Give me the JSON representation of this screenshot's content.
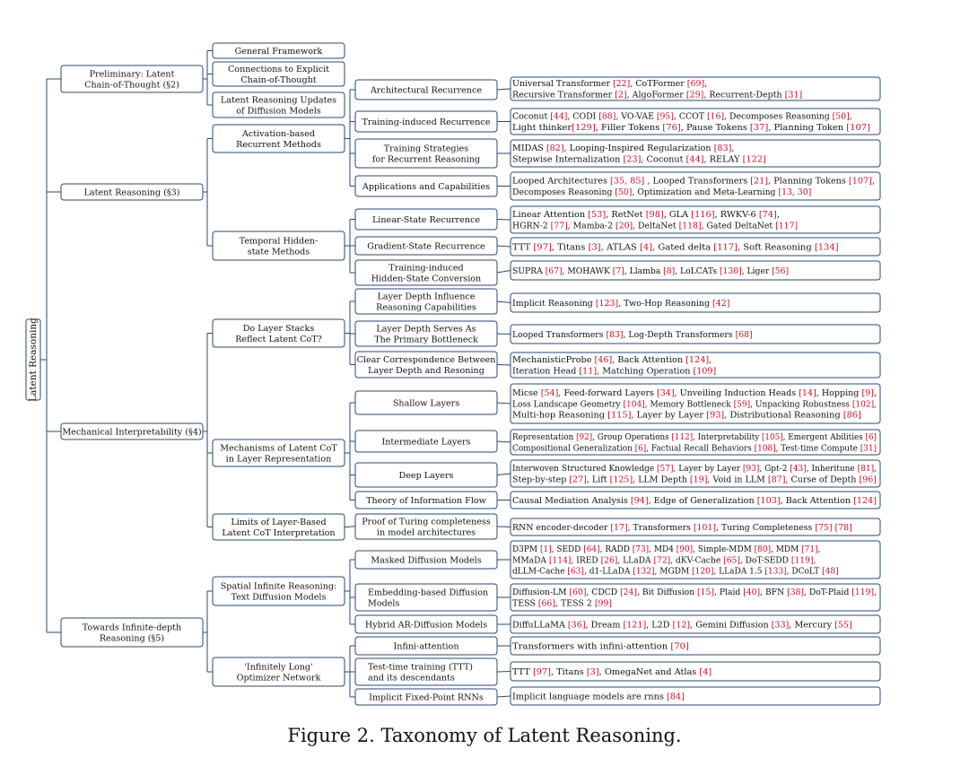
{
  "caption": "Figure 2. Taxonomy of Latent Reasoning.",
  "root": "Latent Reasoning",
  "tree": [
    {
      "id": "prelim",
      "label": [
        "Preliminary: Latent",
        "Chain-of-Thought (§2)"
      ],
      "children": [
        {
          "id": "gf",
          "label": [
            "General Framework"
          ]
        },
        {
          "id": "conn",
          "label": [
            "Connections to Explicit",
            "Chain-of-Thought"
          ]
        },
        {
          "id": "lrud",
          "label": [
            "Latent Reasoning Updates",
            "of Diffusion Models"
          ]
        }
      ]
    },
    {
      "id": "lr3",
      "label": [
        "Latent Reasoning (§3)"
      ],
      "children": [
        {
          "id": "arm",
          "label": [
            "Activation-based",
            "Recurrent Methods"
          ],
          "children": [
            {
              "id": "archrec",
              "label": [
                "Architectural Recurrence"
              ],
              "leaf": [
                "Universal Transformer [22], CoTFormer [69],",
                "Recursive Transformer [2], AlgoFormer [29], Recurrent-Depth [31]"
              ]
            },
            {
              "id": "trainrec",
              "label": [
                "Training-induced Recurrence"
              ],
              "leaf": [
                "Coconut [44], CODI [88], VO-VAE [95], CCOT [16], Decomposes Reasoning [50],",
                "Light thinker[129], Filler Tokens [76], Pause Tokens [37], Planning Token [107]"
              ]
            },
            {
              "id": "tsrr",
              "label": [
                "Training Strategies",
                "for Recurrent Reasoning"
              ],
              "leaf": [
                "MIDAS [82], Looping-Inspired Regularization [83],",
                "Stepwise Internalization [23], Coconut [44], RELAY [122]"
              ]
            },
            {
              "id": "appcap",
              "label": [
                "Applications and Capabilities"
              ],
              "leaf": [
                "Looped Architectures [35, 85] , Looped Transformers [21], Planning Tokens [107],",
                "Decomposes Reasoning [50], Optimization and Meta-Learning [13, 30]"
              ]
            }
          ]
        },
        {
          "id": "thsm",
          "label": [
            "Temporal Hidden-",
            "state Methods"
          ],
          "children": [
            {
              "id": "lsr",
              "label": [
                "Linear-State Recurrence"
              ],
              "leaf": [
                "Linear Attention [53], RetNet [98], GLA [116], RWKV-6 [74],",
                "HGRN-2 [77], Mamba-2 [20], DeltaNet [118], Gated DeltaNet [117]"
              ]
            },
            {
              "id": "gsr",
              "label": [
                "Gradient-State Recurrence"
              ],
              "leaf": [
                "TTT [97], Titans [3], ATLAS [4], Gated delta [117], Soft Reasoning [134]"
              ]
            },
            {
              "id": "tihsc",
              "label": [
                "Training-induced",
                "Hidden-State Conversion"
              ],
              "leaf": [
                "SUPRA [67], MOHAWK [7], Llamba [8], LoLCATs [130], Liger [56]"
              ]
            }
          ]
        }
      ]
    },
    {
      "id": "mi4",
      "label": [
        "Mechanical Interpretability (§4)"
      ],
      "children": [
        {
          "id": "dls",
          "label": [
            "Do Layer Stacks",
            "Reflect Latent CoT?"
          ],
          "children": [
            {
              "id": "ldirc",
              "label": [
                "Layer Depth Influence",
                "Reasoning Capabilities"
              ],
              "leaf": [
                "Implicit Reasoning [123], Two-Hop Reasoning [42]"
              ]
            },
            {
              "id": "ldspb",
              "label": [
                "Layer Depth Serves As",
                "The Primary Bottleneck"
              ],
              "leaf": [
                "Looped Transformers [83], Log-Depth Transformers [68]"
              ]
            },
            {
              "id": "ccb",
              "label": [
                "Clear Correspondence Between",
                "Layer Depth and Resoning"
              ],
              "leaf": [
                "MechanisticProbe [46], Back Attention [124],",
                "Iteration Head [11], Matching Operation [109]"
              ]
            }
          ]
        },
        {
          "id": "mlcot",
          "label": [
            "Mechanisms of Latent CoT",
            "in Layer Representation"
          ],
          "children": [
            {
              "id": "shallow",
              "label": [
                "Shallow Layers"
              ],
              "leaf": [
                "Micse [54], Feed-forward Layers [34], Unveiling Induction Heads [14], Hopping [9],",
                "Loss Landscape Geometry [104], Memory Bottleneck [59], Unpacking Robustness [102],",
                "Multi-hop Reasoning [115], Layer by Layer [93], Distributional Reasoning [86]"
              ]
            },
            {
              "id": "inter",
              "label": [
                "Intermediate Layers"
              ],
              "leaf": [
                "Representation [92], Group Operations [112], Interpretability [105], Emergent Abilities [6]",
                "Compositional Generalization [6], Factual Recall Behaviors [108], Test-time Compute [31]"
              ]
            },
            {
              "id": "deep",
              "label": [
                "Deep Layers"
              ],
              "leaf": [
                "Interwoven Structured Knowledge [57], Layer by Layer [93], Gpt-2 [43], Inheritune [81],",
                "Step-by-step [27], Lift [125], LLM Depth [19], Void in LLM [87], Curse of Depth [96]"
              ]
            },
            {
              "id": "tif",
              "label": [
                "Theory of Information Flow"
              ],
              "leaf": [
                "Causal Mediation Analysis [94], Edge of Generalization [103], Back Attention [124]"
              ]
            }
          ]
        },
        {
          "id": "limits",
          "label": [
            "Limits of Layer-Based",
            "Latent CoT Interpretation"
          ],
          "children": [
            {
              "id": "ptc",
              "label": [
                "Proof of Turing completeness",
                "in model architectures"
              ],
              "leaf": [
                "RNN encoder-decoder [17], Transformers [101], Turing Completeness [75] [78]"
              ]
            }
          ]
        }
      ]
    },
    {
      "id": "tidr",
      "label": [
        "Towards Infinite-depth",
        "Reasoning (§5)"
      ],
      "children": [
        {
          "id": "sir",
          "label": [
            "Spatial Infinite Reasoning:",
            "Text Diffusion Models"
          ],
          "children": [
            {
              "id": "mdm",
              "label": [
                "Masked Diffusion Models"
              ],
              "leaf": [
                "D3PM [1], SEDD [64], RADD [73], MD4 [90], Simple-MDM [80], MDM [71],",
                "MMaDA [114], IRED [26], LLaDA [72], dKV-Cache [65], DoT-SEDD [119],",
                "dLLM-Cache [63], d1-LLaDA [132], MGDM [120], LLaDA 1.5 [133], DCoLT [48]"
              ]
            },
            {
              "id": "ebdm",
              "label": [
                "Embedding-based Diffusion",
                "Models"
              ],
              "align": "left",
              "leaf": [
                "Diffusion-LM [60], CDCD [24], Bit Diffusion [15], Plaid [40], BFN [38], DoT-Plaid [119],",
                "TESS [66], TESS 2 [99]"
              ]
            },
            {
              "id": "hard",
              "label": [
                "Hybrid AR-Diffusion Models"
              ],
              "leaf": [
                "DiffuLLaMA [36], Dream [121], L2D [12], Gemini Diffusion [33], Mercury [55]"
              ]
            }
          ]
        },
        {
          "id": "ilon",
          "label": [
            "'Infinitely Long'",
            "Optimizer Network"
          ],
          "children": [
            {
              "id": "infatt",
              "label": [
                "Infini-attention"
              ],
              "leaf": [
                "Transformers with infini-attention [70]"
              ]
            },
            {
              "id": "ttt",
              "label": [
                "Test-time training (TTT)",
                "and its descendants"
              ],
              "align": "left",
              "leaf": [
                "TTT [97], Titans [3], OmegaNet and Atlas [4]"
              ]
            },
            {
              "id": "ifp",
              "label": [
                "Implicit Fixed-Point RNNs"
              ],
              "leaf": [
                "Implicit language models are rnns [84]"
              ]
            }
          ]
        }
      ]
    }
  ],
  "colors": {
    "box_stroke": "#2a4a6e",
    "edge": "#2a4a6e",
    "ref": "#c0102a",
    "text": "#111111"
  }
}
